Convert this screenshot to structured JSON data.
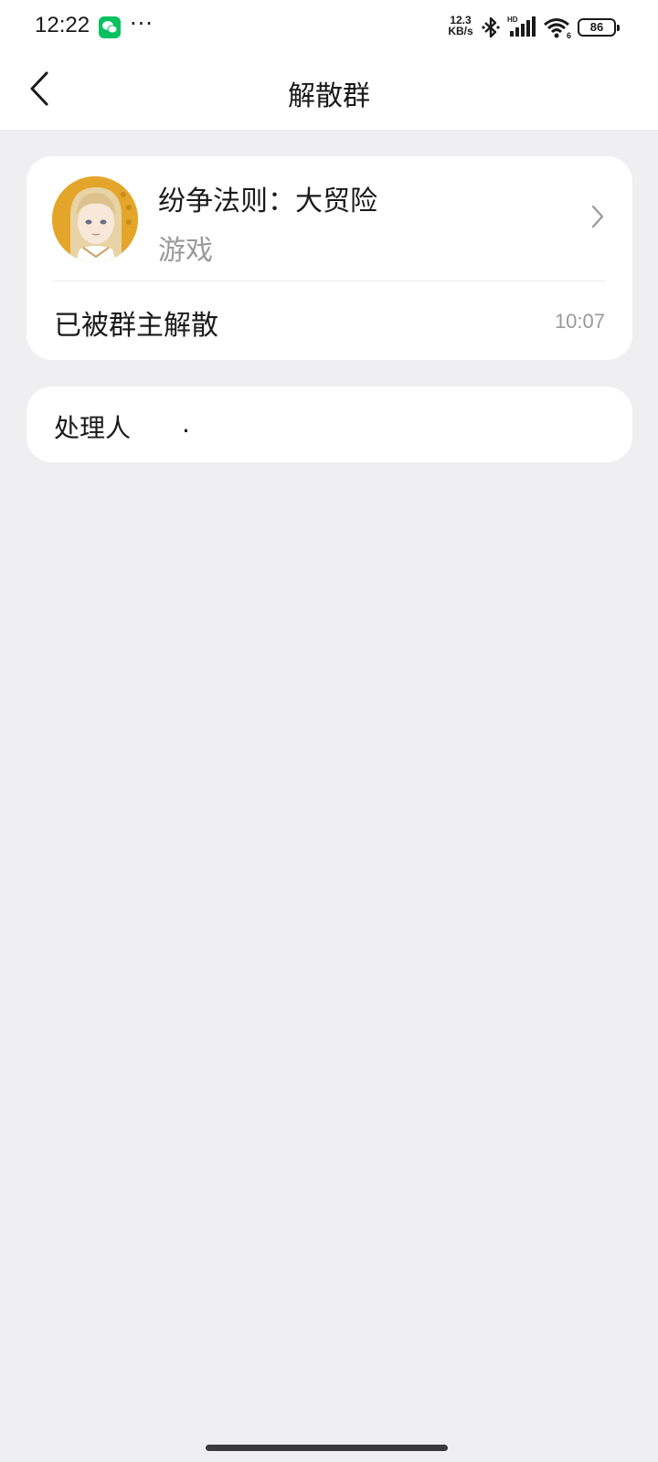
{
  "status_bar": {
    "time": "12:22",
    "more": "···",
    "net_speed_value": "12.3",
    "net_speed_unit": "KB/s",
    "signal_label": "HD",
    "wifi_label": "6",
    "battery": "86"
  },
  "nav": {
    "title": "解散群"
  },
  "group": {
    "name": "纷争法则：大贸险",
    "category": "游戏",
    "status": "已被群主解散",
    "time": "10:07"
  },
  "handler": {
    "label": "处理人",
    "value": "."
  },
  "colors": {
    "background": "#efeff1",
    "card": "#ffffff",
    "secondary_text": "#9a9a9a",
    "wechat_green": "#07c160"
  },
  "icons": [
    "wechat-icon",
    "bluetooth-icon",
    "signal-icon",
    "wifi-icon",
    "battery-icon",
    "back-arrow-icon",
    "chevron-right-icon"
  ]
}
